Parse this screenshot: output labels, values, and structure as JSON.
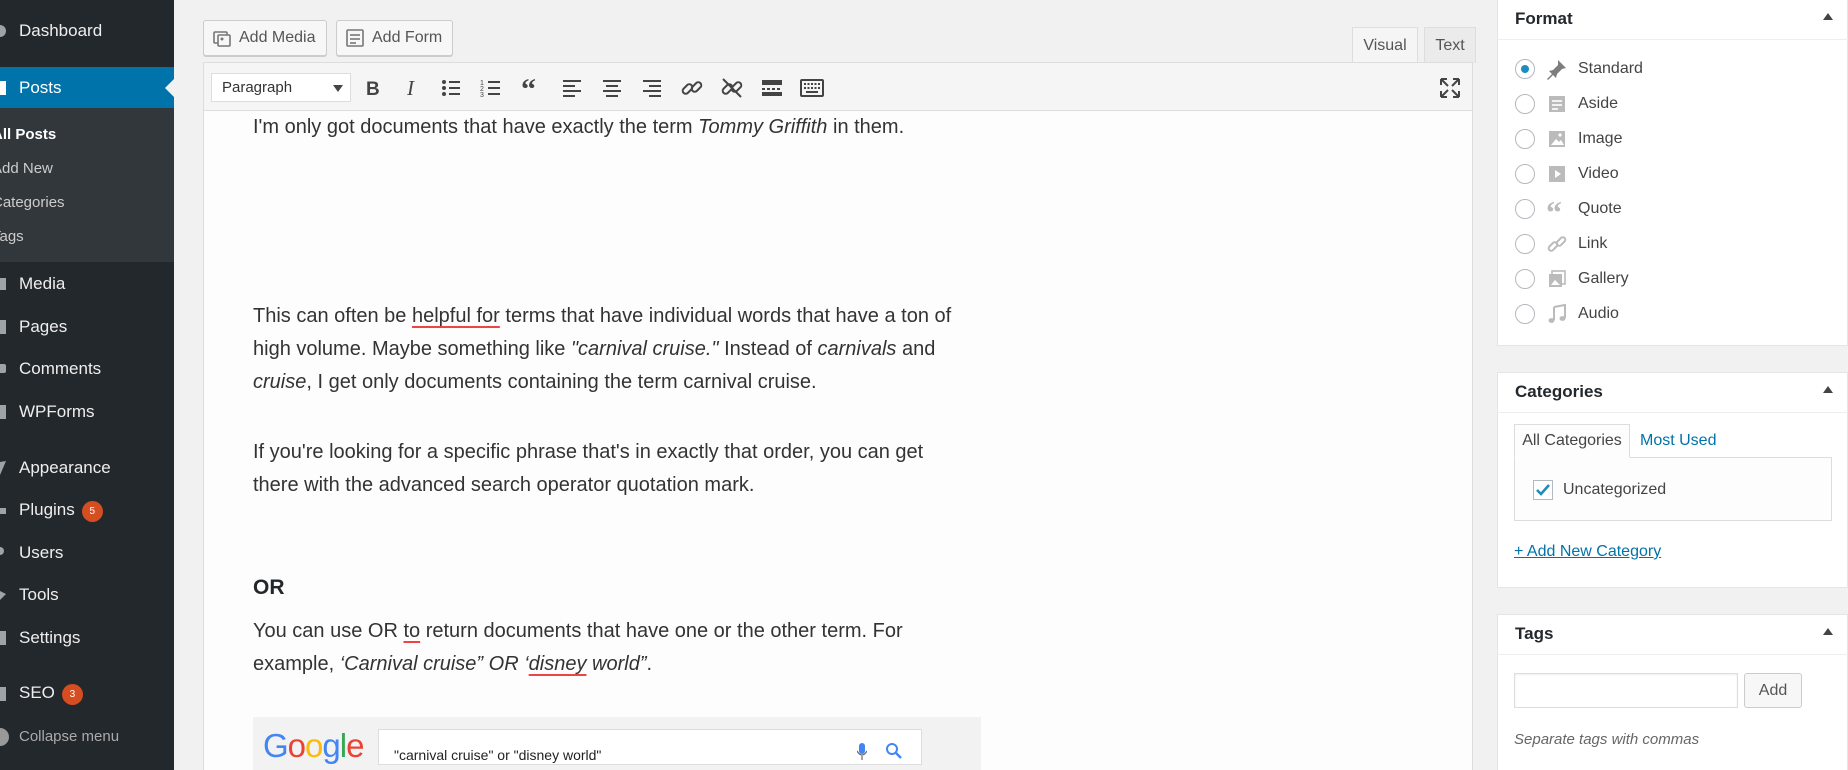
{
  "sidebar": {
    "dashboard": "Dashboard",
    "posts": "Posts",
    "submenu": [
      "All Posts",
      "Add New",
      "Categories",
      "Tags"
    ],
    "media": "Media",
    "pages": "Pages",
    "comments": "Comments",
    "wpforms": "WPForms",
    "appearance": "Appearance",
    "plugins": "Plugins",
    "plugins_badge": "5",
    "users": "Users",
    "tools": "Tools",
    "settings": "Settings",
    "seo": "SEO",
    "seo_badge": "3",
    "collapse": "Collapse menu"
  },
  "editor": {
    "add_media": "Add Media",
    "add_form": "Add Form",
    "tab_visual": "Visual",
    "tab_text": "Text",
    "format_select": "Paragraph",
    "toolbar_icons": [
      "bold-icon",
      "italic-icon",
      "bulleted-list-icon",
      "numbered-list-icon",
      "blockquote-icon",
      "align-left-icon",
      "align-center-icon",
      "align-right-icon",
      "insert-link-icon",
      "remove-link-icon",
      "read-more-icon",
      "toolbar-toggle-icon",
      "fullscreen-icon"
    ],
    "p1": {
      "a": "I'm only got documents that have exactly the term ",
      "b": "Tommy Griffith",
      "c": " in them."
    },
    "p2": {
      "a": "This can often be ",
      "b": "helpful for",
      "c": " terms that have individual words that have a ton of high volume. Maybe something like ",
      "d": "\"carnival cruise.\"",
      "e": " Instead of ",
      "f": "carnivals",
      "g": " and ",
      "h": "cruise",
      "i": ", I get only documents containing the term carnival cruise."
    },
    "p3": "If you're looking for a specific phrase that's in exactly that order, you can get there with the advanced search operator quotation mark.",
    "heading_or": "OR",
    "p4": {
      "a": "You can use OR ",
      "b": "to",
      "c": " return documents that have one or the other term. For example, ",
      "d": "‘Carnival cruise” OR ‘",
      "e": "disney",
      "f": " world”",
      "g": "."
    },
    "google_logo": "Google",
    "google_query": "\"carnival cruise\" or \"disney world\""
  },
  "format_box": {
    "title": "Format",
    "options": [
      {
        "label": "Standard",
        "icon": "pin-icon",
        "checked": true
      },
      {
        "label": "Aside",
        "icon": "aside-icon",
        "checked": false
      },
      {
        "label": "Image",
        "icon": "image-icon",
        "checked": false
      },
      {
        "label": "Video",
        "icon": "video-icon",
        "checked": false
      },
      {
        "label": "Quote",
        "icon": "quote-icon",
        "checked": false
      },
      {
        "label": "Link",
        "icon": "link-icon",
        "checked": false
      },
      {
        "label": "Gallery",
        "icon": "gallery-icon",
        "checked": false
      },
      {
        "label": "Audio",
        "icon": "audio-icon",
        "checked": false
      }
    ]
  },
  "categories_box": {
    "title": "Categories",
    "tab_all": "All Categories",
    "tab_used": "Most Used",
    "item": "Uncategorized",
    "add_new": "+ Add New Category"
  },
  "tags_box": {
    "title": "Tags",
    "add_button": "Add",
    "hint": "Separate tags with commas"
  },
  "colors": {
    "sidebar": "#23282d",
    "active": "#0073aa",
    "badge": "#d54e21"
  }
}
